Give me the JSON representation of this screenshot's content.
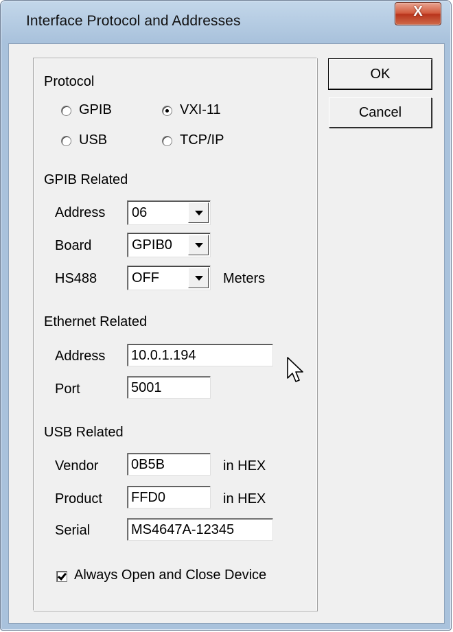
{
  "window": {
    "title": "Interface Protocol and Addresses",
    "close_symbol": "X"
  },
  "buttons": {
    "ok": "OK",
    "cancel": "Cancel"
  },
  "protocol": {
    "heading": "Protocol",
    "options": {
      "gpib": "GPIB",
      "vxi11": "VXI-11",
      "usb": "USB",
      "tcpip": "TCP/IP"
    },
    "selected": "VXI-11"
  },
  "gpib": {
    "heading": "GPIB Related",
    "address_label": "Address",
    "address_value": "06",
    "board_label": "Board",
    "board_value": "GPIB0",
    "hs488_label": "HS488",
    "hs488_value": "OFF",
    "hs488_suffix": "Meters"
  },
  "ethernet": {
    "heading": "Ethernet Related",
    "address_label": "Address",
    "address_value": "10.0.1.194",
    "port_label": "Port",
    "port_value": "5001"
  },
  "usb": {
    "heading": "USB Related",
    "vendor_label": "Vendor",
    "vendor_value": "0B5B",
    "vendor_suffix": "in HEX",
    "product_label": "Product",
    "product_value": "FFD0",
    "product_suffix": "in HEX",
    "serial_label": "Serial",
    "serial_value": "MS4647A-12345"
  },
  "always_open": {
    "label": "Always Open and Close Device",
    "checked": true
  },
  "icons": {
    "close": "close-icon",
    "cursor": "mouse-cursor-icon",
    "dropdown": "chevron-down-icon"
  }
}
